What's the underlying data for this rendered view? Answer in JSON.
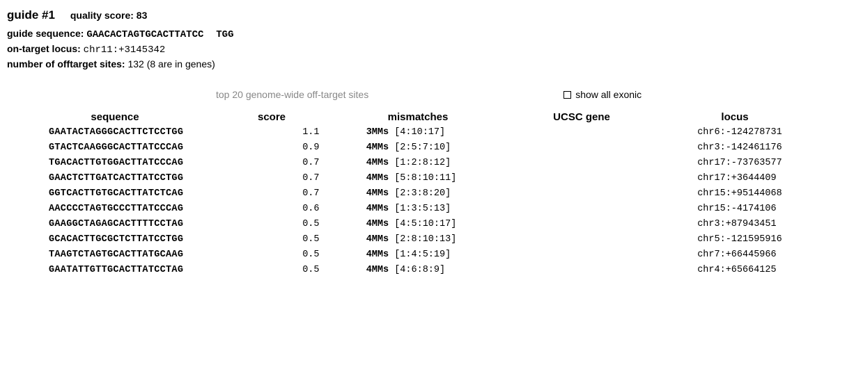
{
  "header": {
    "guide_title": "guide #1",
    "quality_label": "quality score:",
    "quality_value": "83",
    "guide_sequence_label": "guide sequence:",
    "guide_sequence_seq": "GAACACTAGTGCACTTATCC",
    "guide_sequence_pam": "TGG",
    "on_target_label": "on-target locus:",
    "on_target_value": "chr11:+3145342",
    "offtarget_count_label": "number of offtarget sites:",
    "offtarget_count_value": "132 (8 are in genes)"
  },
  "subheader": {
    "caption": "top 20 genome-wide off-target sites",
    "show_exonic_label": "show all exonic"
  },
  "columns": {
    "sequence": "sequence",
    "score": "score",
    "mismatches": "mismatches",
    "ucsc_gene": "UCSC gene",
    "locus": "locus"
  },
  "rows": [
    {
      "seq": "GAATACTAGGGCACTTCTCCTGG",
      "score": "1.1",
      "mm_prefix": "3MMs",
      "mm_positions": "[4:10:17]",
      "gene": "",
      "locus": "chr6:-124278731"
    },
    {
      "seq": "GTACTCAAGGGCACTTATCCCAG",
      "score": "0.9",
      "mm_prefix": "4MMs",
      "mm_positions": "[2:5:7:10]",
      "gene": "",
      "locus": "chr3:-142461176"
    },
    {
      "seq": "TGACACTTGTGGACTTATCCCAG",
      "score": "0.7",
      "mm_prefix": "4MMs",
      "mm_positions": "[1:2:8:12]",
      "gene": "",
      "locus": "chr17:-73763577"
    },
    {
      "seq": "GAACTCTTGATCACTTATCCTGG",
      "score": "0.7",
      "mm_prefix": "4MMs",
      "mm_positions": "[5:8:10:11]",
      "gene": "",
      "locus": "chr17:+3644409"
    },
    {
      "seq": "GGTCACTTGTGCACTTATCTCAG",
      "score": "0.7",
      "mm_prefix": "4MMs",
      "mm_positions": "[2:3:8:20]",
      "gene": "",
      "locus": "chr15:+95144068"
    },
    {
      "seq": "AACCCCTAGTGCCCTTATCCCAG",
      "score": "0.6",
      "mm_prefix": "4MMs",
      "mm_positions": "[1:3:5:13]",
      "gene": "",
      "locus": "chr15:-4174106"
    },
    {
      "seq": "GAAGGCTAGAGCACTTTTCCTAG",
      "score": "0.5",
      "mm_prefix": "4MMs",
      "mm_positions": "[4:5:10:17]",
      "gene": "",
      "locus": "chr3:+87943451"
    },
    {
      "seq": "GCACACTTGCGCTCTTATCCTGG",
      "score": "0.5",
      "mm_prefix": "4MMs",
      "mm_positions": "[2:8:10:13]",
      "gene": "",
      "locus": "chr5:-121595916"
    },
    {
      "seq": "TAAGTCTAGTGCACTTATGCAAG",
      "score": "0.5",
      "mm_prefix": "4MMs",
      "mm_positions": "[1:4:5:19]",
      "gene": "",
      "locus": "chr7:+66445966"
    },
    {
      "seq": "GAATATTGTTGCACTTATCCTAG",
      "score": "0.5",
      "mm_prefix": "4MMs",
      "mm_positions": "[4:6:8:9]",
      "gene": "",
      "locus": "chr4:+65664125"
    }
  ]
}
